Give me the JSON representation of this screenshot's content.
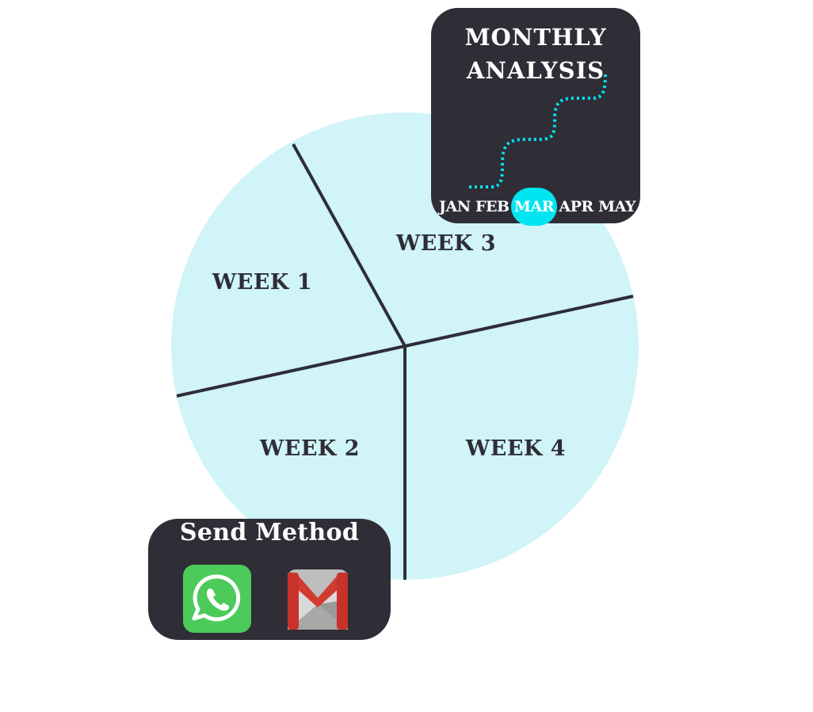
{
  "diagram": {
    "segments": [
      {
        "label": "WEEK 1"
      },
      {
        "label": "WEEK 2"
      },
      {
        "label": "WEEK 3"
      },
      {
        "label": "WEEK 4"
      }
    ],
    "fill_color": "#d0f4f7",
    "line_color": "#2e2d36"
  },
  "monthly_card": {
    "title_line1": "MONTHLY",
    "title_line2": "ANALYSIS",
    "months": [
      "JAN",
      "FEB",
      "MAR",
      "APR",
      "MAY"
    ],
    "active_month": "MAR",
    "accent_color": "#00e5f2",
    "background": "#2f2e37"
  },
  "send_card": {
    "title": "Send Method",
    "icons": [
      "whatsapp-icon",
      "gmail-icon"
    ],
    "background": "#2f2e37"
  }
}
